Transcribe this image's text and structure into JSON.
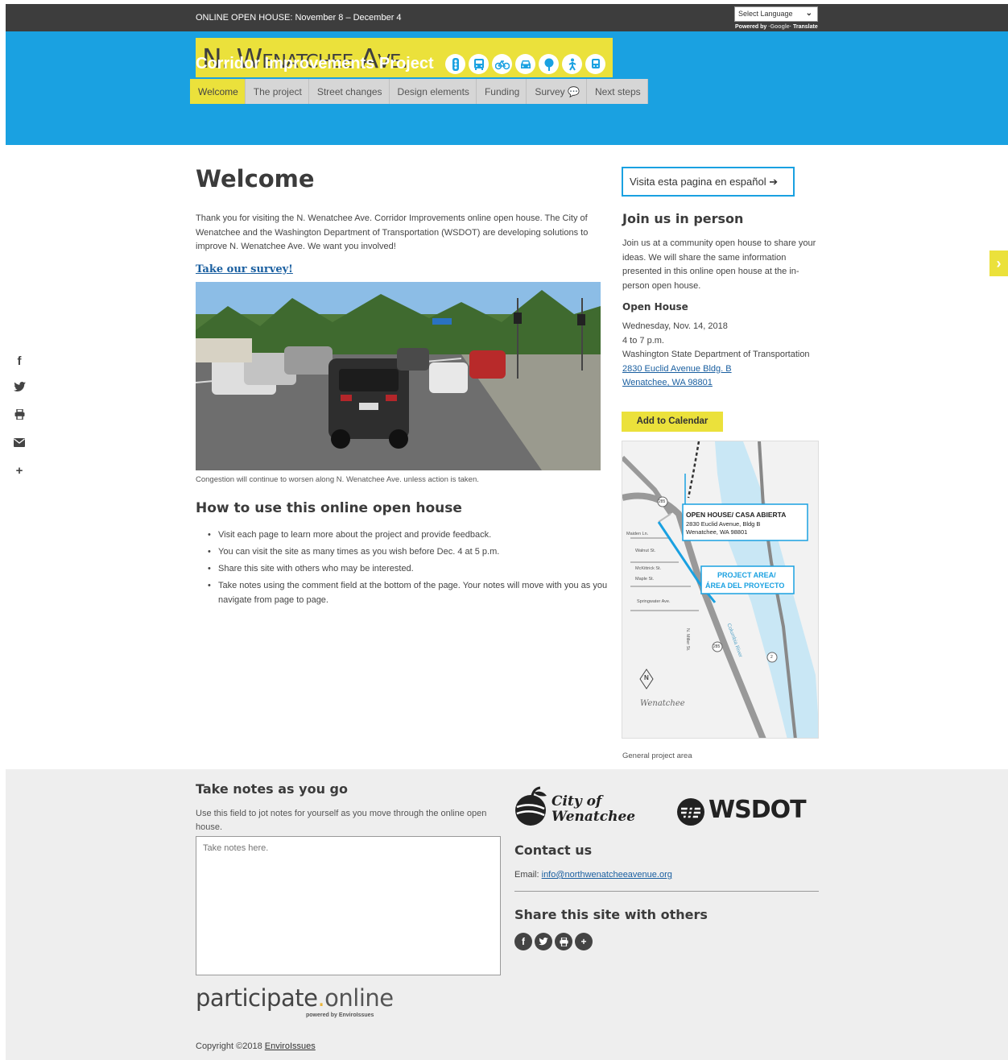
{
  "topbar": {
    "announcement": "ONLINE OPEN HOUSE: November 8 – December 4",
    "language_select": "Select Language",
    "powered_by": "Powered by",
    "translate": "Translate"
  },
  "header": {
    "title": "N. Wenatchee Ave.",
    "subtitle": "Corridor Improvements Project",
    "mode_icons": [
      "traffic-light-icon",
      "bus-icon",
      "bike-icon",
      "car-icon",
      "tree-icon",
      "pedestrian-icon",
      "transit-icon"
    ]
  },
  "nav": {
    "items": [
      {
        "label": "Welcome"
      },
      {
        "label": "The project"
      },
      {
        "label": "Street changes"
      },
      {
        "label": "Design elements"
      },
      {
        "label": "Funding"
      },
      {
        "label": "Survey 💬"
      },
      {
        "label": "Next steps"
      }
    ]
  },
  "main": {
    "heading": "Welcome",
    "intro": "Thank you for visiting the N. Wenatchee Ave. Corridor Improvements online open house. The City of Wenatchee and the Washington Department of Transportation (WSDOT) are developing solutions to improve N. Wenatchee Ave. We want you involved!",
    "survey_link": "Take our survey!",
    "photo_caption": "Congestion will continue to worsen along N. Wenatchee Ave. unless action is taken.",
    "howto_heading": "How to use this online open house",
    "bullets": [
      "Visit each page to learn more about the project and provide feedback.",
      "You can visit the site as many times as you wish before Dec. 4 at 5 p.m.",
      "Share this site with others who may be interested.",
      "Take notes using the comment field at the bottom of the page. Your notes will move with you as you navigate from page to page."
    ]
  },
  "sidebar": {
    "espanol_button": "Visita esta pagina en español ➔",
    "join_heading": "Join us in person",
    "join_text": "Join us at a community open house to share your ideas. We will share the same information presented in this online open house at the in-person open house.",
    "open_house_heading": "Open House",
    "date": "Wednesday, Nov. 14, 2018",
    "time": "4 to 7 p.m.",
    "venue": "Washington State Department of Transportation",
    "address_line1": "2830 Euclid Avenue Bldg. B",
    "address_line2": "Wenatchee, WA 98801",
    "calendar_button": "Add to Calendar",
    "map": {
      "callout_title": "OPEN HOUSE/ CASA ABIERTA",
      "callout_line1": "2830 Euclid Avenue, Bldg B",
      "callout_line2": "Wenatchee, WA 98801",
      "project_area_1": "PROJECT AREA/",
      "project_area_2": "ÁREA DEL PROYECTO",
      "city_label": "Wenatchee",
      "north": "N",
      "river": "Columbia River",
      "streets": [
        "Maiden Ln.",
        "Walnut St.",
        "McKittrick St.",
        "Maple St.",
        "Springwater Ave.",
        "N. Miller St."
      ],
      "route_labels": [
        "285",
        "285",
        "2"
      ]
    },
    "map_caption": "General project area"
  },
  "social_side": [
    "facebook-icon",
    "twitter-icon",
    "print-icon",
    "email-icon",
    "plus-icon"
  ],
  "footer": {
    "notes_heading": "Take notes as you go",
    "notes_text": "Use this field to jot notes for yourself as you move through the online open house.",
    "notes_placeholder": "Take notes here.",
    "participate_main": "participate",
    "participate_dot": ".",
    "participate_online": "online",
    "participate_powered": "powered by EnviroIssues",
    "copyright_prefix": "Copyright ©2018 ",
    "copyright_link": "EnviroIssues",
    "city_logo_line1": "City of",
    "city_logo_line2": "Wenatchee",
    "wsdot_logo": "WSDOT",
    "contact_heading": "Contact us",
    "contact_label": "Email: ",
    "contact_email": "info@northwenatcheeavenue.org",
    "share_heading": "Share this site with others"
  },
  "colors": {
    "accent_yellow": "#ebe13b",
    "header_blue": "#1aa1e1",
    "topbar_dark": "#3d3d3d",
    "link_blue": "#1a5fa0"
  }
}
